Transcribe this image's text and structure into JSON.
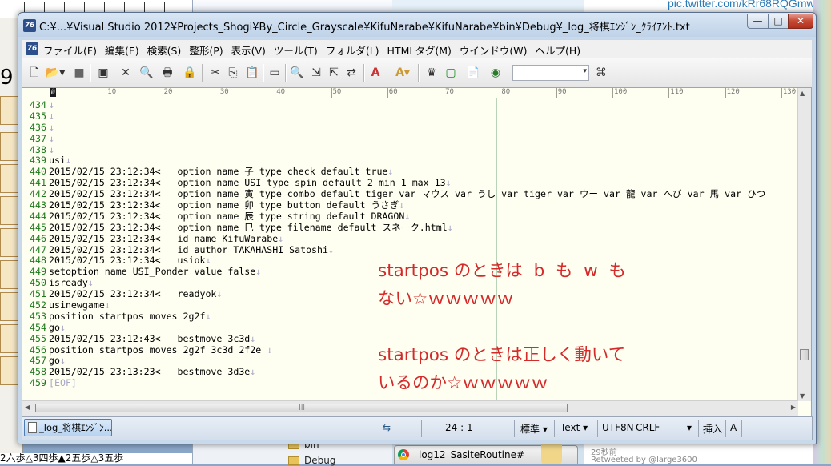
{
  "background": {
    "twitter_link": "pic.twitter.com/kRr68RQGmw",
    "bottom_left_text": "2六歩△3四歩▲2五歩△3五歩",
    "folders": [
      "bin",
      "Debug"
    ],
    "browser_tab": "_log12_SasiteRoutine#",
    "tweet_time": "29秒前",
    "tweet_retweet": "Retweeted by @large3600",
    "board_digit": "9"
  },
  "window": {
    "title": "C:¥...¥Visual Studio 2012¥Projects_Shogi¥By_Circle_Grayscale¥KifuNarabe¥KifuNarabe¥bin¥Debug¥_log_将棋ｴﾝｼﾞﾝ_ｸﾗｲｱﾝﾄ.txt",
    "buttons": {
      "minimize": "—",
      "maximize": "□",
      "close": "✕"
    }
  },
  "menu": [
    "ファイル(F)",
    "編集(E)",
    "検索(S)",
    "整形(P)",
    "表示(V)",
    "ツール(T)",
    "フォルダ(L)",
    "HTMLタグ(M)",
    "ウインドウ(W)",
    "ヘルプ(H)"
  ],
  "toolbar": {
    "icons": [
      "new-file-icon",
      "open-folder-icon",
      "save-icon",
      "close-doc-icon",
      "print-preview-icon",
      "print-icon",
      "lock-icon",
      "cut-icon",
      "copy-icon",
      "paste-icon",
      "window-icon",
      "find-icon",
      "find-next-icon",
      "find-prev-icon",
      "replace-icon",
      "font-color-icon",
      "font-icon",
      "crown-icon",
      "frame-icon",
      "clipboard-icon",
      "browser-icon",
      "binoculars-icon"
    ],
    "search_value": ""
  },
  "ruler": {
    "marks": [
      "0",
      "10",
      "20",
      "30",
      "40",
      "50",
      "60",
      "70",
      "80",
      "90",
      "100",
      "110",
      "120",
      "130"
    ]
  },
  "editor": {
    "lines": [
      {
        "n": "434",
        "t": ""
      },
      {
        "n": "435",
        "t": ""
      },
      {
        "n": "436",
        "t": ""
      },
      {
        "n": "437",
        "t": ""
      },
      {
        "n": "438",
        "t": ""
      },
      {
        "n": "439",
        "t": "usi"
      },
      {
        "n": "440",
        "t": "2015/02/15 23:12:34<   option name 子 type check default true"
      },
      {
        "n": "441",
        "t": "2015/02/15 23:12:34<   option name USI type spin default 2 min 1 max 13"
      },
      {
        "n": "442",
        "t": "2015/02/15 23:12:34<   option name 寅 type combo default tiger var マウス var うし var tiger var ウー var 龍 var へび var 馬 var ひつ"
      },
      {
        "n": "443",
        "t": "2015/02/15 23:12:34<   option name 卯 type button default うさぎ"
      },
      {
        "n": "444",
        "t": "2015/02/15 23:12:34<   option name 辰 type string default DRAGON"
      },
      {
        "n": "445",
        "t": "2015/02/15 23:12:34<   option name 巳 type filename default スネーク.html"
      },
      {
        "n": "446",
        "t": "2015/02/15 23:12:34<   id name KifuWarabe"
      },
      {
        "n": "447",
        "t": "2015/02/15 23:12:34<   id author TAKAHASHI Satoshi"
      },
      {
        "n": "448",
        "t": "2015/02/15 23:12:34<   usiok"
      },
      {
        "n": "449",
        "t": "setoption name USI_Ponder value false"
      },
      {
        "n": "450",
        "t": "isready"
      },
      {
        "n": "451",
        "t": "2015/02/15 23:12:34<   readyok"
      },
      {
        "n": "452",
        "t": "usinewgame"
      },
      {
        "n": "453",
        "t": "position startpos moves 2g2f"
      },
      {
        "n": "454",
        "t": "go"
      },
      {
        "n": "455",
        "t": "2015/02/15 23:12:43<   bestmove 3c3d"
      },
      {
        "n": "456",
        "t": "position startpos moves 2g2f 3c3d 2f2e "
      },
      {
        "n": "457",
        "t": "go"
      },
      {
        "n": "458",
        "t": "2015/02/15 23:13:23<   bestmove 3d3e"
      },
      {
        "n": "459",
        "t": "[EOF]"
      }
    ],
    "eol_mark": "↓",
    "annotations": [
      "startpos のときは  b  も  w  も",
      "ない☆ｗｗｗｗｗ",
      "",
      "startpos のときは正しく動いて",
      "いるのか☆ｗｗｗｗｗ"
    ]
  },
  "status": {
    "doc_tab": "_log_将棋ｴﾝｼﾞﾝ...",
    "position": "24 : 1",
    "mode": "標準",
    "filetype": "Text",
    "encoding": "UTF8N",
    "eol": "CRLF",
    "insert": "挿入",
    "input": "A"
  }
}
